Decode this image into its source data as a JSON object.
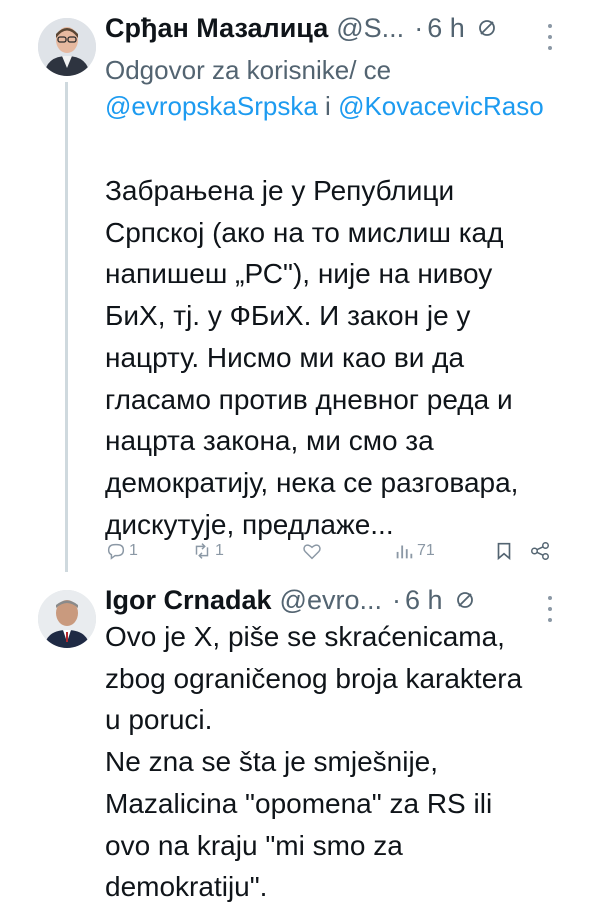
{
  "tweets": [
    {
      "author_name": "Срђан Мазалица",
      "handle": "@S...",
      "time": "6 h",
      "reply_prefix": "Odgovor za korisnike/ ce",
      "reply_mention_1": "@evropskaSrpska",
      "reply_and": "i",
      "reply_mention_2": "@KovacevicRaso",
      "text": "Забрањена је у Републици\nСрпској (ако на то мислиш кад\nнапишеш „РС\"), није на нивоу\nБиХ, тј. у ФБиХ. И закон је у\nнацрту. Нисмо ми као ви да\nгласамо против дневног реда и\nнацрта закона, ми смо за\nдемократију, нека се разговара,\nдискутује, предлаже...",
      "replies": "1",
      "reposts": "1",
      "likes": "",
      "views": "71"
    },
    {
      "author_name": "Igor Crnadak",
      "handle": "@evro...",
      "time": "6 h",
      "text": "Ovo je X, piše se skraćenicama,\nzbog ograničenog broja karaktera\nu poruci.\nNe zna se šta je smješnije,\nMazalicina \"opomena\" za RS ili\novo na kraju \"mi smo za\ndemokratiju\"."
    }
  ],
  "icons": {
    "globe": "globe-icon",
    "more": "more-icon",
    "reply": "reply-icon",
    "repost": "repost-icon",
    "like": "like-icon",
    "views": "views-icon",
    "bookmark": "bookmark-icon",
    "share": "share-icon"
  },
  "colors": {
    "text": "#0f1419",
    "secondary": "#536471",
    "link": "#1d9bf0",
    "icon": "#8b98a5"
  }
}
